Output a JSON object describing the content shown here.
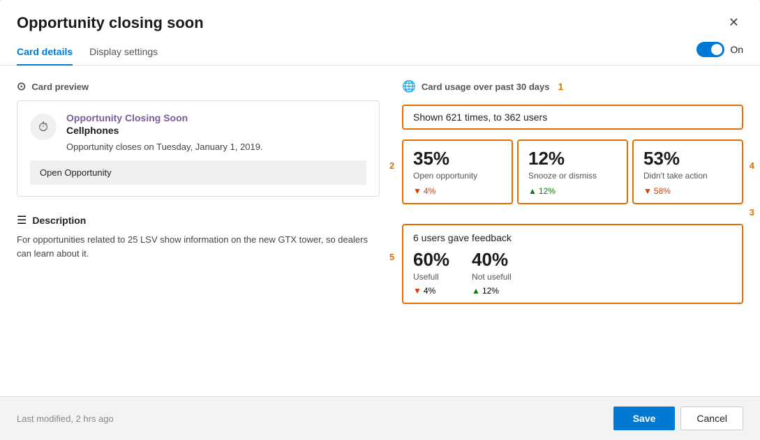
{
  "dialog": {
    "title": "Opportunity closing soon",
    "close_label": "✕"
  },
  "tabs": {
    "card_details_label": "Card details",
    "display_settings_label": "Display settings",
    "active": "Card details"
  },
  "toggle": {
    "state": "On",
    "checked": true
  },
  "card_preview": {
    "section_label": "Card preview",
    "icon": "⏱",
    "title": "Opportunity Closing Soon",
    "subtitle": "Cellphones",
    "body": "Opportunity closes on Tuesday, January 1, 2019.",
    "action": "Open Opportunity"
  },
  "description": {
    "section_label": "Description",
    "text": "For opportunities related to 25 LSV show information on the new GTX tower, so dealers can learn about it."
  },
  "usage": {
    "section_label": "Card usage over past 30 days",
    "shown_text": "Shown 621 times, to 362 users",
    "annot_1": "1",
    "annot_2": "2",
    "annot_3": "3",
    "annot_4": "4",
    "annot_5": "5",
    "stats": [
      {
        "percent": "35%",
        "label": "Open opportunity",
        "change": "4%",
        "direction": "down"
      },
      {
        "percent": "12%",
        "label": "Snooze or dismiss",
        "change": "12%",
        "direction": "up"
      },
      {
        "percent": "53%",
        "label": "Didn't take action",
        "change": "58%",
        "direction": "down"
      }
    ],
    "feedback": {
      "title": "6 users gave feedback",
      "stats": [
        {
          "percent": "60%",
          "label": "Usefull",
          "change": "4%",
          "direction": "down"
        },
        {
          "percent": "40%",
          "label": "Not usefull",
          "change": "12%",
          "direction": "up"
        }
      ]
    }
  },
  "footer": {
    "modified_text": "Last modified, 2 hrs ago",
    "save_label": "Save",
    "cancel_label": "Cancel"
  }
}
